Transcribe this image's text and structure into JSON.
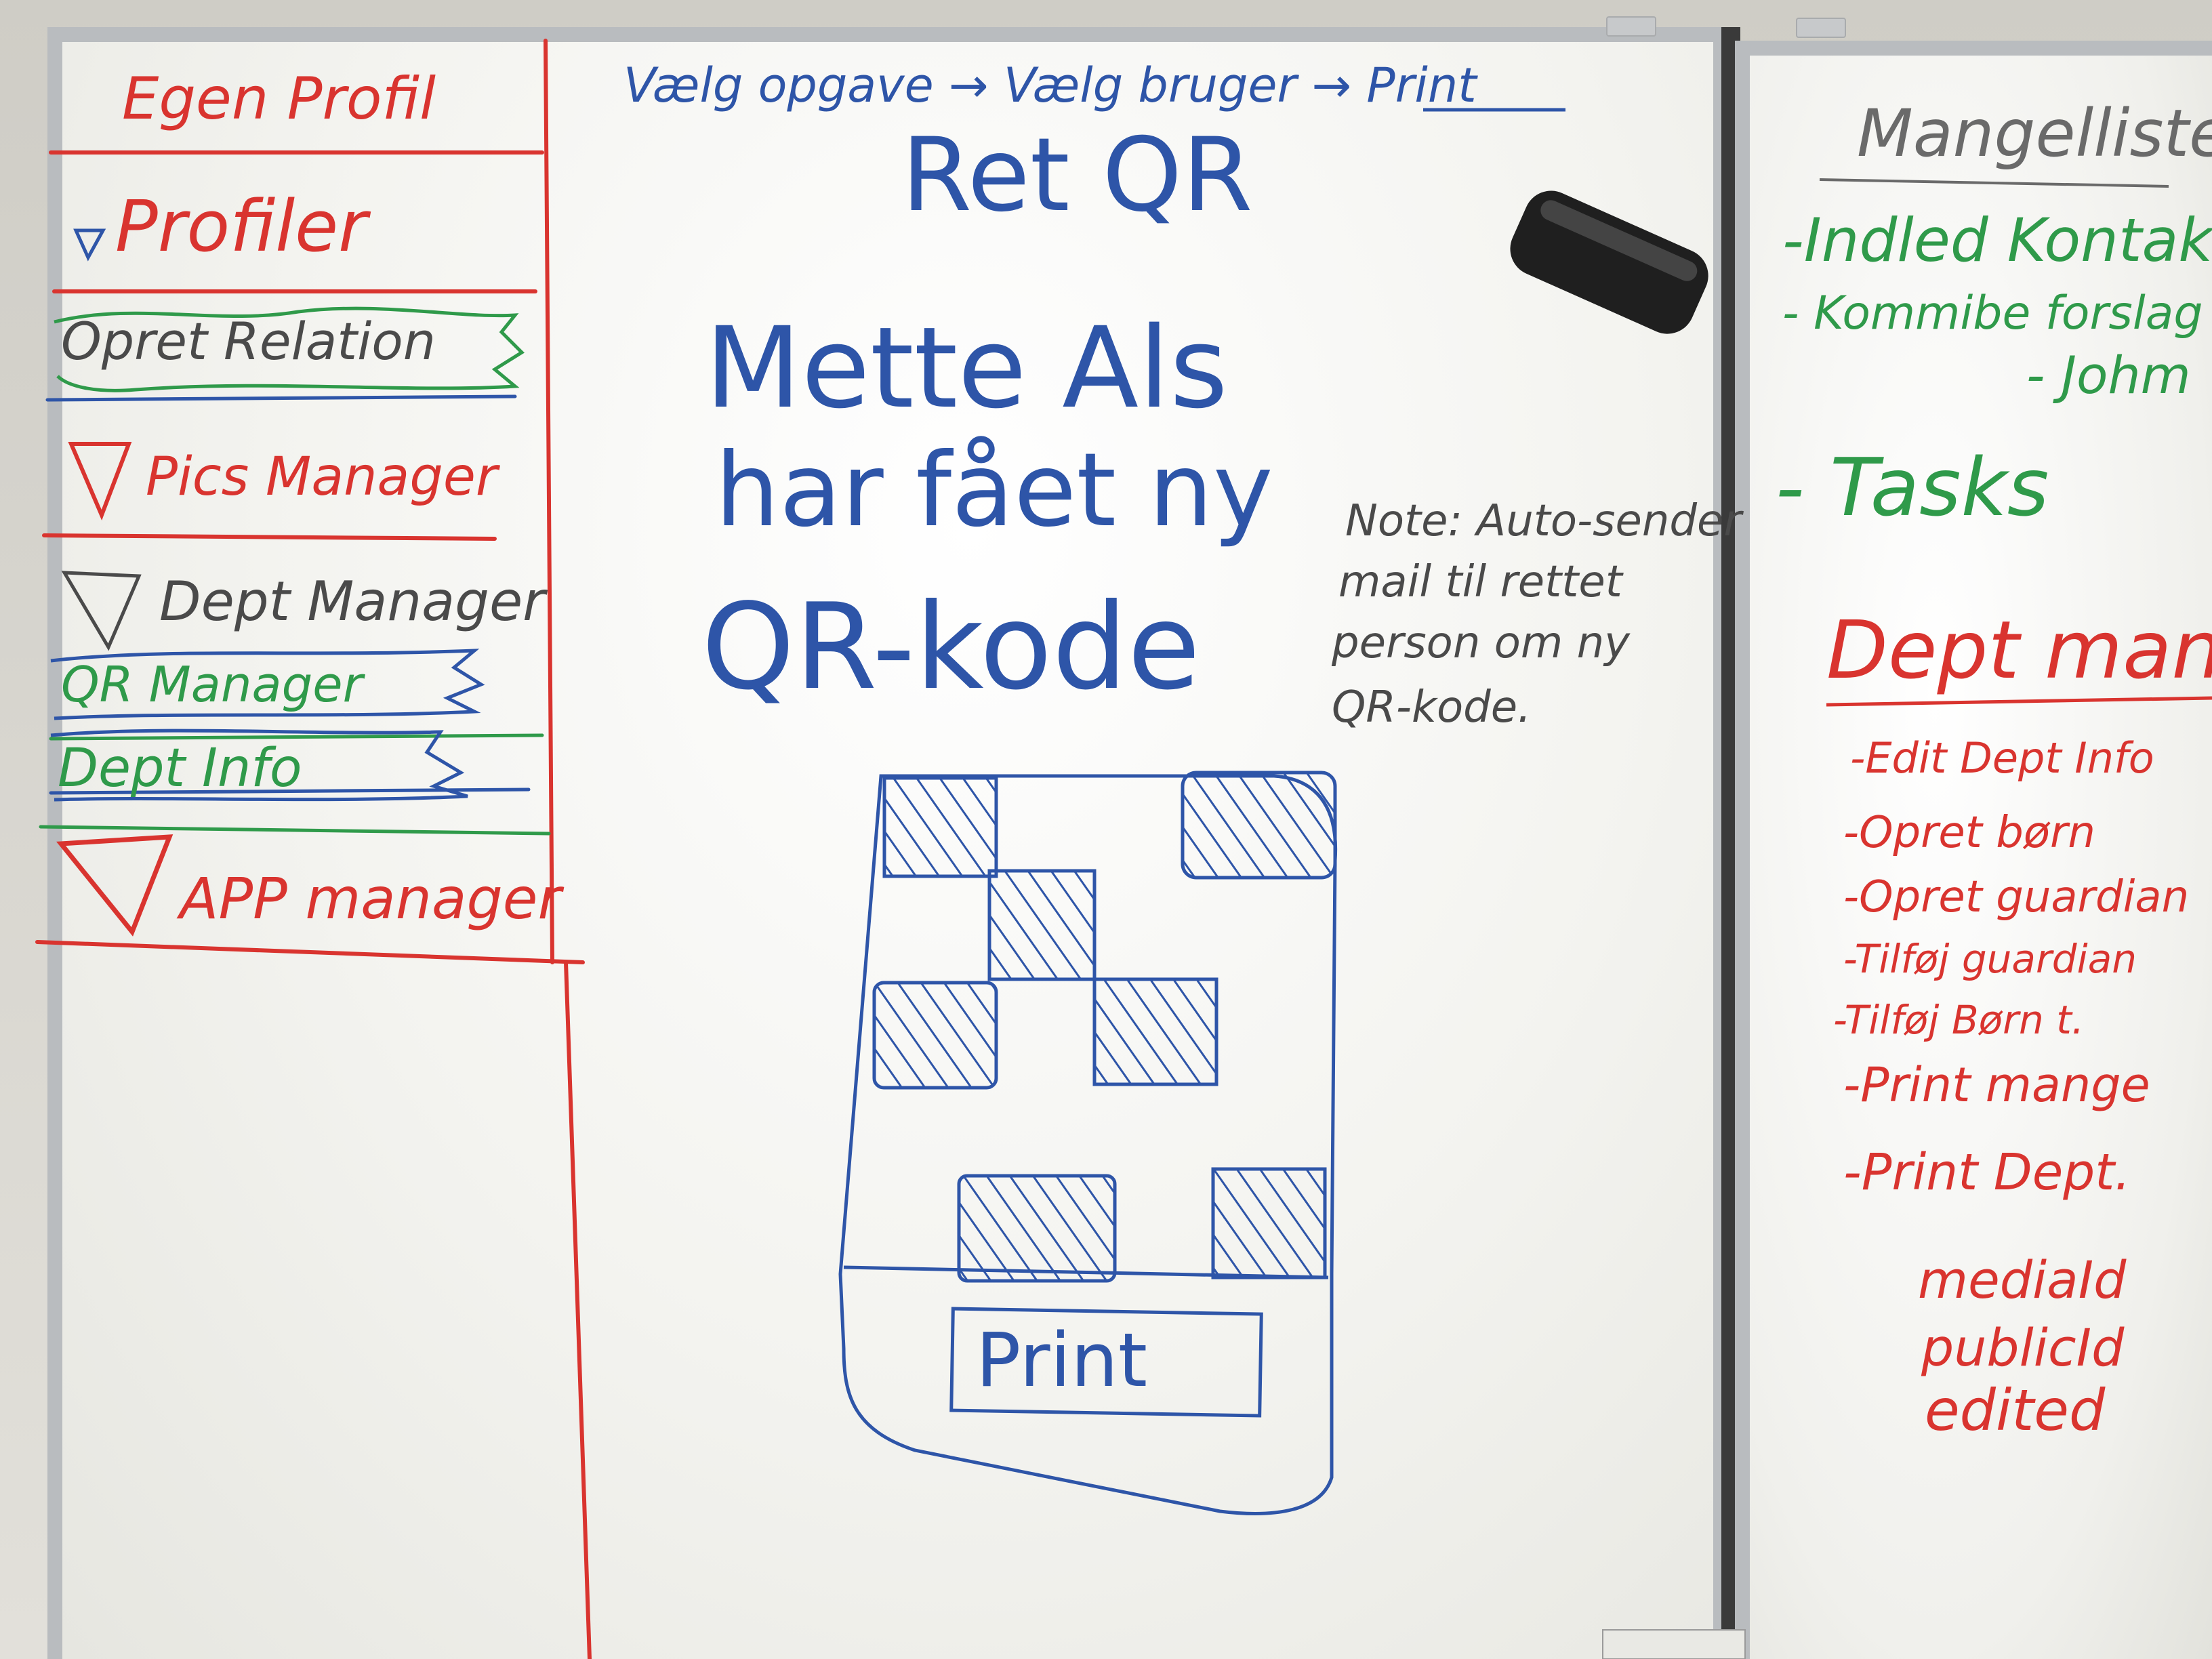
{
  "sidebar": {
    "items": [
      {
        "label": "Egen Profil"
      },
      {
        "label": "Profiler"
      },
      {
        "label": "Opret Relation"
      },
      {
        "label": "Pics Manager"
      },
      {
        "label": "Dept Manager"
      },
      {
        "label": "QR Manager"
      },
      {
        "label": "Dept Info"
      },
      {
        "label": "APP manager"
      }
    ]
  },
  "flow_text": "Vælg opgave → Vælg bruger → Print",
  "screen_title": "Ret QR",
  "message": {
    "line1": "Mette Als",
    "line2": "har fået ny",
    "line3": "QR-kode"
  },
  "note": {
    "line1": "Note: Auto-sender",
    "line2": "mail til rettet",
    "line3": "person om ny",
    "line4": "QR-kode."
  },
  "mockup": {
    "print_button": "Print"
  },
  "right_board": {
    "header": "Mangelliste",
    "green_items": [
      "-Indled Kontakt",
      "- Kommibe forslag",
      "- Johm",
      "- Tasks"
    ],
    "section_title": "Dept manag",
    "red_items": [
      "-Edit Dept Info",
      "-Opret børn",
      "-Opret guardian",
      "-Tilføj guardian",
      "-Tilføj Børn t.",
      "-Print mange",
      "-Print Dept."
    ],
    "fields": [
      "mediaId",
      "publicId",
      "edited"
    ]
  },
  "colors": {
    "red_marker": "#d9342f",
    "blue_marker": "#2e55a8",
    "green_marker": "#2f9a4a",
    "black_marker": "#4a4a4a"
  }
}
